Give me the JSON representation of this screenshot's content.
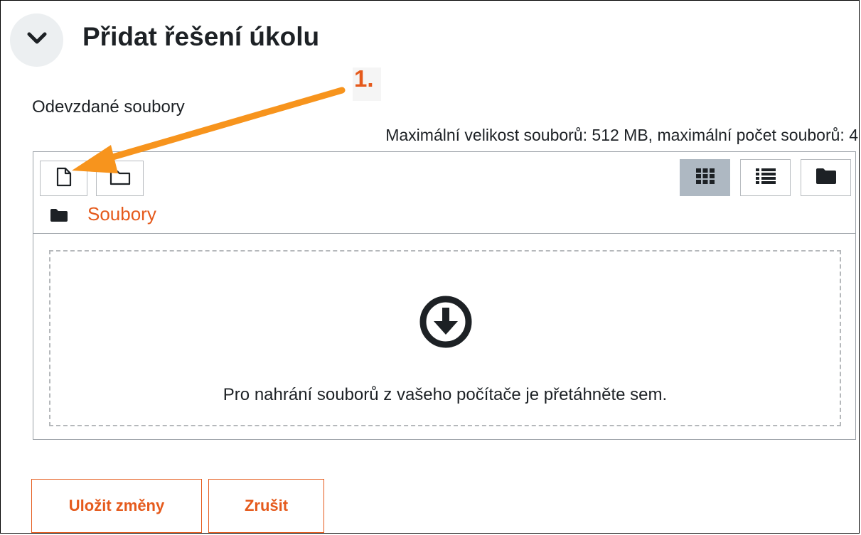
{
  "section": {
    "title": "Přidat řešení úkolu",
    "collapse_icon": "chevron-down-icon"
  },
  "annotation": {
    "step_label": "1.",
    "color": "#e55a1c",
    "arrow_color": "#f7941d"
  },
  "field": {
    "label": "Odevzdané soubory",
    "limits_text": "Maximální velikost souborů: 512 MB, maximální počet souborů: 4"
  },
  "file_manager": {
    "toolbar": {
      "add_file_icon": "file-icon",
      "create_folder_icon": "folder-outline-icon"
    },
    "views": {
      "icons_icon": "grid-icon",
      "list_icon": "list-icon",
      "tree_icon": "folder-icon",
      "active": "icons"
    },
    "breadcrumb": {
      "icon": "folder-icon",
      "label": "Soubory"
    },
    "dropzone": {
      "icon": "download-circle-icon",
      "text": "Pro nahrání souborů z vašeho počítače je přetáhněte sem."
    }
  },
  "actions": {
    "save_label": "Uložit změny",
    "cancel_label": "Zrušit"
  },
  "colors": {
    "accent": "#e55a1c",
    "active_view_bg": "#aeb8c2"
  }
}
